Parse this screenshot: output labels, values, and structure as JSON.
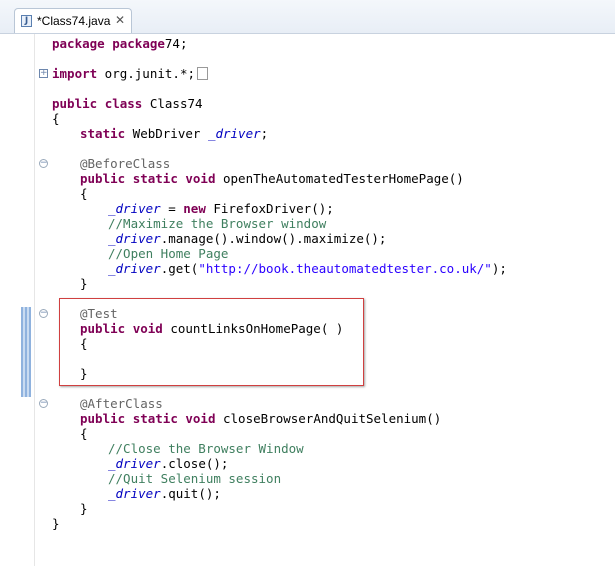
{
  "tab": {
    "title": "*Class74.java",
    "close_glyph": "✕",
    "icon_letter": "J"
  },
  "code_lines": [
    "package package74;",
    "import org.junit.*;",
    "public class Class74",
    "{",
    "static WebDriver _driver;",
    "@BeforeClass",
    "public static void openTheAutomatedTesterHomePage()",
    "{",
    "_driver = new FirefoxDriver();",
    "//Maximize the Browser window",
    "_driver.manage().window().maximize();",
    "//Open Home Page",
    "_driver.get(\"http://book.theautomatedtester.co.uk/\");",
    "}",
    "@Test",
    "public void countLinksOnHomePage( )",
    "{",
    "}",
    "@AfterClass",
    "public static void closeBrowserAndQuitSelenium()",
    "{",
    "//Close the Browser Window",
    "_driver.close();",
    "//Quit Selenium session",
    "_driver.quit();",
    "}",
    "}"
  ],
  "colors": {
    "keyword": "#7f0055",
    "field": "#0000c0",
    "annotation": "#646464",
    "comment": "#3f7f5f",
    "string": "#2a00ff",
    "highlight_border": "#d04040"
  },
  "icons": {
    "file": "java-file-icon",
    "close": "close-icon",
    "expand": "fold-expand-icon",
    "collapse": "fold-collapse-icon"
  }
}
